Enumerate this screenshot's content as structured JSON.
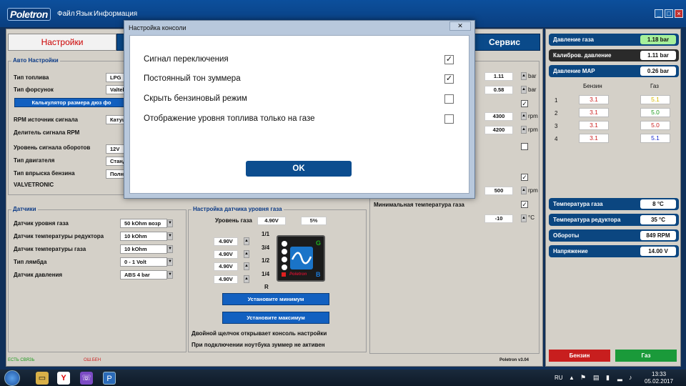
{
  "app": {
    "logo": "Poletron",
    "menu": [
      "Файл",
      "Язык",
      "Информация"
    ]
  },
  "nav": {
    "settings": "Настройки",
    "service": "Сервис"
  },
  "auto": {
    "title": "Авто Настройки",
    "fuel_type_label": "Тип топлива",
    "fuel_type_value": "LPG",
    "injector_label": "Тип форсунок",
    "injector_value": "Valtek",
    "calc_button": "Калькулятор размера дюз фо",
    "rpm_source_label": "RPM источник сигнала",
    "rpm_source_value": "Катуш",
    "rpm_divider_label": "Делитель сигнала RPM",
    "rpm_level_label": "Уровень сигнала оборотов",
    "rpm_level_value": "12V",
    "engine_label": "Тип двигателя",
    "engine_value": "Станд",
    "injection_label": "Тип впрыска бензина",
    "injection_value": "Полн",
    "valvetronic_label": "VALVETRONIC"
  },
  "params": {
    "val1": "1.11",
    "unit1": "bar",
    "val2": "0.58",
    "unit2": "bar",
    "val3": "4300",
    "unit3": "rpm",
    "val4": "4200",
    "unit4": "rpm",
    "val5": "500",
    "unit5": "rpm",
    "min_gas_temp_label": "Минимальная температура газа",
    "val6": "-10",
    "unit6": "°C"
  },
  "sensors": {
    "title": "Датчики",
    "items": [
      {
        "label": "Датчик уровня газа",
        "value": "50 kOhm возр"
      },
      {
        "label": "Датчик температуры редуктора",
        "value": "10 kOhm"
      },
      {
        "label": "Датчик температуры газа",
        "value": "10 kOhm"
      },
      {
        "label": "Тип лямбда",
        "value": "0 - 1 Volt"
      },
      {
        "label": "Датчик давления",
        "value": "ABS 4 bar"
      }
    ]
  },
  "level": {
    "title": "Настройка датчика уровня газа",
    "gas_level_label": "Уровень газа",
    "gas_level_value": "4.90V",
    "percent": "5%",
    "volts": [
      "4.90V",
      "4.90V",
      "4.90V",
      "4.90V"
    ],
    "fractions": [
      "1/1",
      "3/4",
      "1/2",
      "1/4",
      "R"
    ],
    "switch_g": "G",
    "switch_b": "B",
    "switch_brand": "Poletron",
    "set_min": "Установите минимум",
    "set_max": "Установите максимум",
    "hint1": "Двойной щелчок открывает консоль настройки",
    "hint2": "При подключении ноутбука зуммер не активен"
  },
  "right": {
    "gas_pressure_label": "Давление газа",
    "gas_pressure_value": "1.18 bar",
    "calib_pressure_label": "Калибров. давление",
    "calib_pressure_value": "1.11 bar",
    "map_label": "Давление MAP",
    "map_value": "0.26 bar",
    "col_petrol": "Бензин",
    "col_gas": "Газ",
    "rows": [
      {
        "n": "1",
        "petrol": "3.1",
        "gas": "5.1",
        "gas_color": "#d6b800"
      },
      {
        "n": "2",
        "petrol": "3.1",
        "gas": "5.0",
        "gas_color": "#1a9a1a"
      },
      {
        "n": "3",
        "petrol": "3.1",
        "gas": "5.0",
        "gas_color": "#cc2222"
      },
      {
        "n": "4",
        "petrol": "3.1",
        "gas": "5.1",
        "gas_color": "#1a2ad0"
      }
    ],
    "gas_temp_label": "Температура газа",
    "gas_temp_value": "8 °C",
    "reducer_temp_label": "Температура редуктора",
    "reducer_temp_value": "35 °C",
    "rpm_label": "Обороты",
    "rpm_value": "849 RPM",
    "voltage_label": "Напряжение",
    "voltage_value": "14.00 V",
    "petrol_button": "Бензин",
    "gas_button": "Газ"
  },
  "status": {
    "left": "ЕСТЬ СВЯЗЬ",
    "mid": "ОШ.БЕН",
    "version": "Poletron v3.04"
  },
  "dialog": {
    "title": "Настройка консоли",
    "close": "✕",
    "options": [
      {
        "label": "Сигнал переключения",
        "checked": "✓"
      },
      {
        "label": "Постоянный тон зуммера",
        "checked": "✓"
      },
      {
        "label": "Скрыть бензиновый режим",
        "checked": ""
      },
      {
        "label": "Отображение уровня топлива только на газе",
        "checked": ""
      }
    ],
    "ok": "OK"
  },
  "taskbar": {
    "lang": "RU",
    "time": "13:33",
    "date": "05.02.2017"
  },
  "colors": {
    "accent": "#0b4680",
    "petrol_button": "#c81e1e",
    "gas_button": "#1a9a3a"
  }
}
